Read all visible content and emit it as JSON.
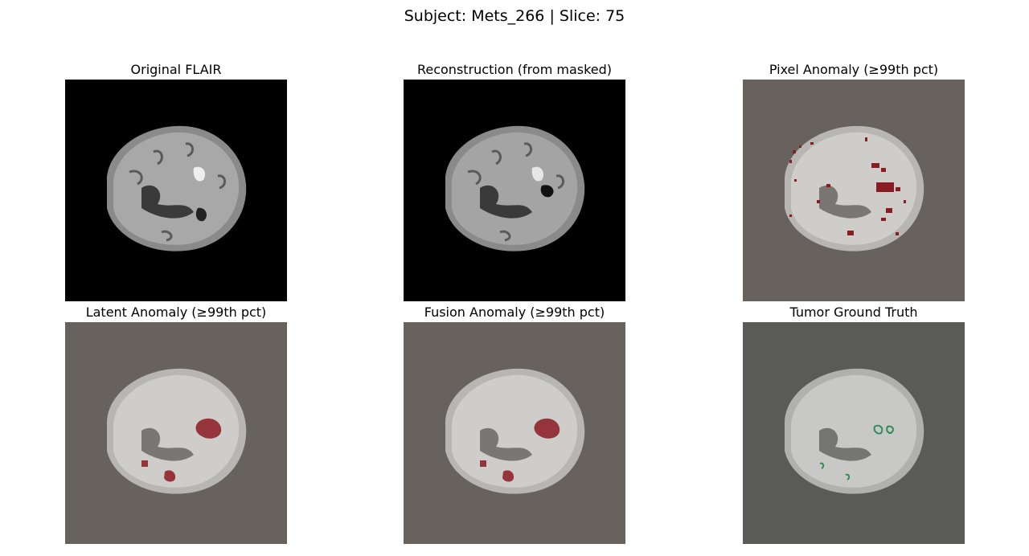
{
  "figure": {
    "suptitle": "Subject: Mets_266 | Slice: 75"
  },
  "panels": [
    {
      "title": "Original FLAIR",
      "background": "#000000",
      "overlay": "none"
    },
    {
      "title": "Reconstruction (from masked)",
      "background": "#000000",
      "overlay": "none"
    },
    {
      "title": "Pixel Anomaly (≥99th pct)",
      "background": "#68625f",
      "overlay": "scattered-red"
    },
    {
      "title": "Latent Anomaly (≥99th pct)",
      "background": "#68625f",
      "overlay": "blob-red"
    },
    {
      "title": "Fusion Anomaly (≥99th pct)",
      "background": "#68625f",
      "overlay": "blob-red"
    },
    {
      "title": "Tumor Ground Truth",
      "background": "#5a5a58",
      "overlay": "green-contour"
    }
  ],
  "colors": {
    "anomaly_red": "#8b1a22",
    "tumor_green": "#2e8b57"
  }
}
